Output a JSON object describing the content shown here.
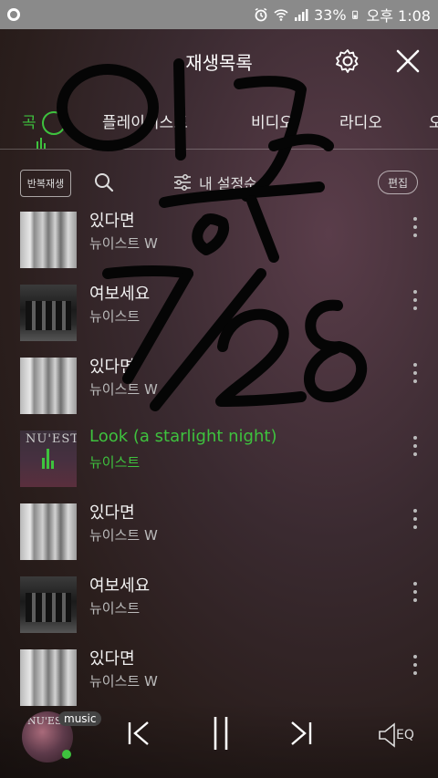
{
  "statusbar": {
    "battery": "33%",
    "time": "오후 1:08"
  },
  "header": {
    "title": "재생목록"
  },
  "tabs": [
    {
      "label": "곡",
      "active": true
    },
    {
      "label": "플레이리스트",
      "active": false
    },
    {
      "label": "비디오",
      "active": false
    },
    {
      "label": "라디오",
      "active": false
    },
    {
      "label": "오",
      "active": false
    }
  ],
  "toolbar": {
    "repeat_label": "반복재생",
    "sort_label": "내 설정순",
    "edit_label": "편집"
  },
  "songs": [
    {
      "title": "있다면",
      "artist": "뉴이스트 W",
      "art": "light"
    },
    {
      "title": "여보세요",
      "artist": "뉴이스트",
      "art": "dark"
    },
    {
      "title": "있다면",
      "artist": "뉴이스트 W",
      "art": "light"
    },
    {
      "title": "Look (a starlight night)",
      "artist": "뉴이스트",
      "art": "cover",
      "playing": true
    },
    {
      "title": "있다면",
      "artist": "뉴이스트 W",
      "art": "light"
    },
    {
      "title": "여보세요",
      "artist": "뉴이스트",
      "art": "dark"
    },
    {
      "title": "있다면",
      "artist": "뉴이스트 W",
      "art": "light"
    }
  ],
  "album_text": "NU'EST",
  "player": {
    "badge": "music",
    "eq_label": "EQ"
  },
  "overlay": {
    "handwriting": "인증 7/28"
  },
  "colors": {
    "accent": "#3ec23e",
    "statusbar": "#8a8a8a"
  }
}
